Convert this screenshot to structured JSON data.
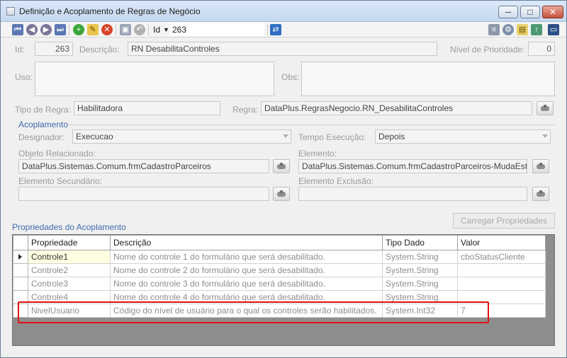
{
  "window": {
    "title": "Definição e Acoplamento de Regras de Negócio",
    "minimize": "─",
    "maximize": "□",
    "close": "✕"
  },
  "toolbar": {
    "id_label": "Id",
    "id_value": "263",
    "icons": [
      "first-record-icon",
      "prev-record-icon",
      "next-record-icon",
      "last-record-icon",
      "add-icon",
      "edit-icon",
      "delete-icon",
      "save-icon",
      "undo-icon",
      "find-icon",
      "list-icon",
      "settings-icon",
      "report-icon",
      "export-icon",
      "window-icon"
    ]
  },
  "form": {
    "id_label": "Id:",
    "id_value": "263",
    "descricao_label": "Descrição:",
    "descricao_value": "RN DesabilitaControles",
    "prioridade_label": "Nível de Prioridade:",
    "prioridade_value": "0",
    "uso_label": "Uso:",
    "uso_value": "",
    "obs_label": "Obs:",
    "obs_value": "",
    "tipo_regra_label": "Tipo de Regra:",
    "tipo_regra_value": "Habilitadora",
    "regra_label": "Regra:",
    "regra_value": "DataPlus.RegrasNegocio.RN_DesabilitaControles"
  },
  "acoplamento": {
    "title": "Acoplamento",
    "designador_label": "Designador:",
    "designador_value": "Execucao",
    "tempo_label": "Tempo Execução:",
    "tempo_value": "Depois",
    "objeto_label": "Objeto Relacionado:",
    "objeto_value": "DataPlus.Sistemas.Comum.frmCadastroParceiros",
    "elemento_label": "Elemento:",
    "elemento_value": "DataPlus.Sistemas.Comum.frmCadastroParceiros-MudaEsta",
    "elem_sec_label": "Elemento Secundário:",
    "elem_sec_value": "",
    "elem_exc_label": "Elemento Exclusão:",
    "elem_exc_value": ""
  },
  "propriedades": {
    "title": "Propriedades do Acoplamento",
    "load_button": "Carregar Propriedades",
    "columns": [
      "Propriedade",
      "Descrição",
      "Tipo Dado",
      "Valor"
    ],
    "rows": [
      {
        "prop": "Controle1",
        "desc": "Nome do controle 1 do formulário que será desabilitado.",
        "tipo": "System.String",
        "valor": "cboStatusCliente"
      },
      {
        "prop": "Controle2",
        "desc": "Nome do controle 2 do formulário que será desabilitado.",
        "tipo": "System.String",
        "valor": ""
      },
      {
        "prop": "Controle3",
        "desc": "Nome do controle 3 do formulário que será desabilitado.",
        "tipo": "System.String",
        "valor": ""
      },
      {
        "prop": "Controle4",
        "desc": "Nome do controle 4 do formulário que será desabilitado.",
        "tipo": "System.String",
        "valor": ""
      },
      {
        "prop": "NivelUsuario",
        "desc": "Código do nível de usuário para o qual os controles serão habilitados.",
        "tipo": "System.Int32",
        "valor": "7"
      }
    ]
  }
}
